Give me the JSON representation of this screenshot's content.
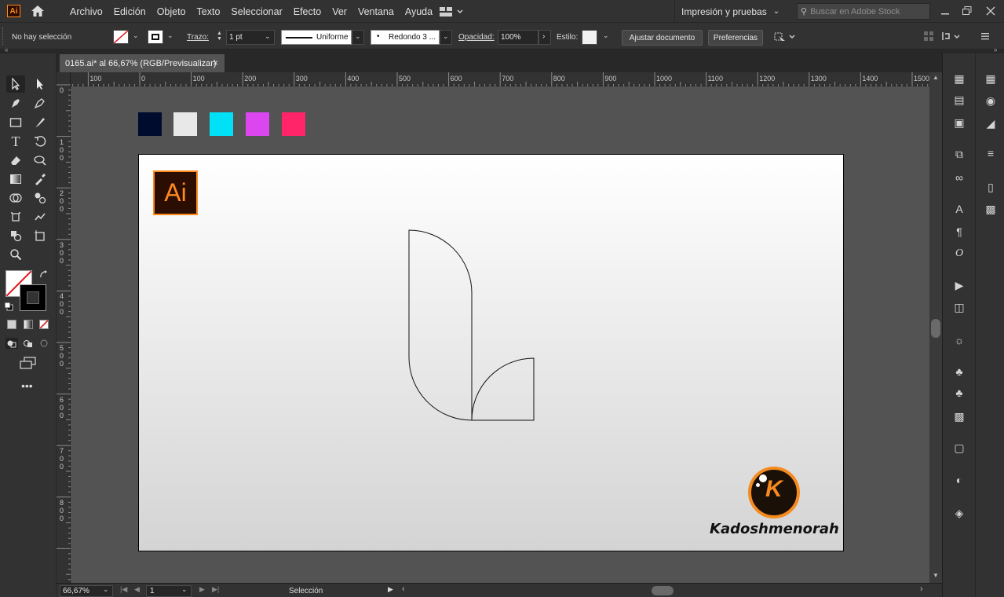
{
  "app": {
    "logo_label": "Ai",
    "menu": [
      "Archivo",
      "Edición",
      "Objeto",
      "Texto",
      "Seleccionar",
      "Efecto",
      "Ver",
      "Ventana",
      "Ayuda"
    ],
    "workspace": "Impresión y pruebas",
    "search_placeholder": "Buscar en Adobe Stock"
  },
  "control_bar": {
    "selection_status": "No hay selección",
    "stroke_label": "Trazo:",
    "stroke_weight": "1 pt",
    "profile": "Uniforme",
    "brush": "Redondo 3 ...",
    "opacity_label": "Opacidad:",
    "opacity_value": "100%",
    "style_label": "Estilo:",
    "doc_setup_button": "Ajustar documento",
    "prefs_button": "Preferencias"
  },
  "document": {
    "tab_title": "0165.ai* al 66,67% (RGB/Previsualizar)"
  },
  "rulers": {
    "h_ticks": [
      "100",
      "0",
      "100",
      "200",
      "300",
      "400",
      "500",
      "600",
      "700",
      "800",
      "900",
      "1000",
      "1100",
      "1200",
      "1300",
      "1400",
      "1500"
    ],
    "v_ticks": [
      [
        "0"
      ],
      [
        "1",
        "0",
        "0"
      ],
      [
        "2",
        "0",
        "0"
      ],
      [
        "3",
        "0",
        "0"
      ],
      [
        "4",
        "0",
        "0"
      ],
      [
        "5",
        "0",
        "0"
      ],
      [
        "6",
        "0",
        "0"
      ],
      [
        "7",
        "0",
        "0"
      ],
      [
        "8",
        "0",
        "0"
      ]
    ]
  },
  "artwork": {
    "swatches": [
      "#000c2e",
      "#e8e8e8",
      "#00e0f7",
      "#db46ef",
      "#ff2568"
    ],
    "badge_text": "Ai",
    "badge_bg": "#2b0d02",
    "badge_color": "#ff8a1e",
    "brand_name": "Kadoshmenorah",
    "brand_letter": "K",
    "brand_orange": "#f58a1f"
  },
  "status": {
    "zoom": "66,67%",
    "artboard_number": "1",
    "current_tool": "Selección"
  },
  "icons": {
    "panel_right": [
      "transform-icon",
      "align-icon",
      "pathfinder-icon",
      "artboards-icon",
      "links-icon",
      "character-icon",
      "paragraph-icon",
      "opentype-icon",
      "actions-icon",
      "asset-export-icon",
      "appearance-icon",
      "symbols-icon",
      "clubs-icon",
      "image-trace-icon",
      "gradient-icon",
      "transparency-icon",
      "layers-icon"
    ],
    "panel_left": [
      "color-guide-icon",
      "color-icon",
      "swatches-icon",
      "stroke-icon",
      "export-icon",
      "brushes-icon"
    ]
  }
}
